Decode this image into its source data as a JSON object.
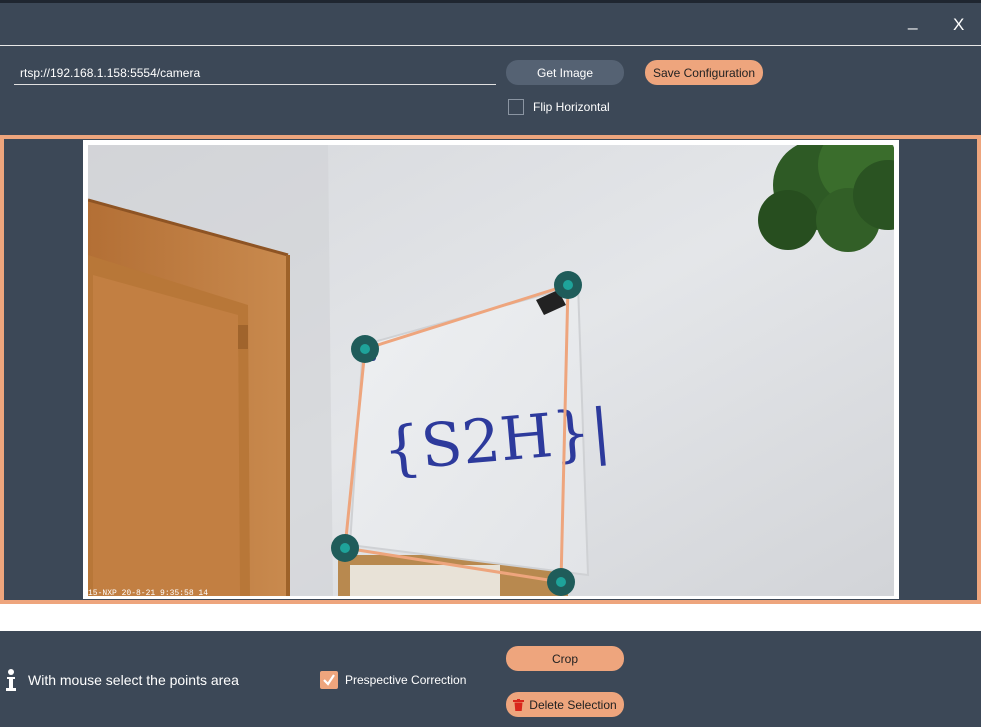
{
  "window": {
    "minimize_label": "_",
    "close_label": "X"
  },
  "toolbar": {
    "url_value": "rtsp://192.168.1.158:5554/camera",
    "get_image_label": "Get Image",
    "save_config_label": "Save Configuration",
    "flip_label": "Flip Horizontal",
    "flip_checked": false
  },
  "viewer": {
    "timestamp": "15-NXP 20-8-21 9:35:58 14",
    "whiteboard_text": "{S2H}|",
    "selection_point_count": 4
  },
  "footer": {
    "hint": "With mouse select the points area",
    "perspective_label": "Prespective Correction",
    "perspective_checked": true,
    "crop_label": "Crop",
    "delete_label": "Delete Selection"
  },
  "colors": {
    "background": "#3c4857",
    "accent": "#eea57d",
    "secondary_button": "#556273",
    "handle": "#1f5c5a",
    "handle_center": "#1ea39a",
    "delete_icon": "#d9261c"
  }
}
